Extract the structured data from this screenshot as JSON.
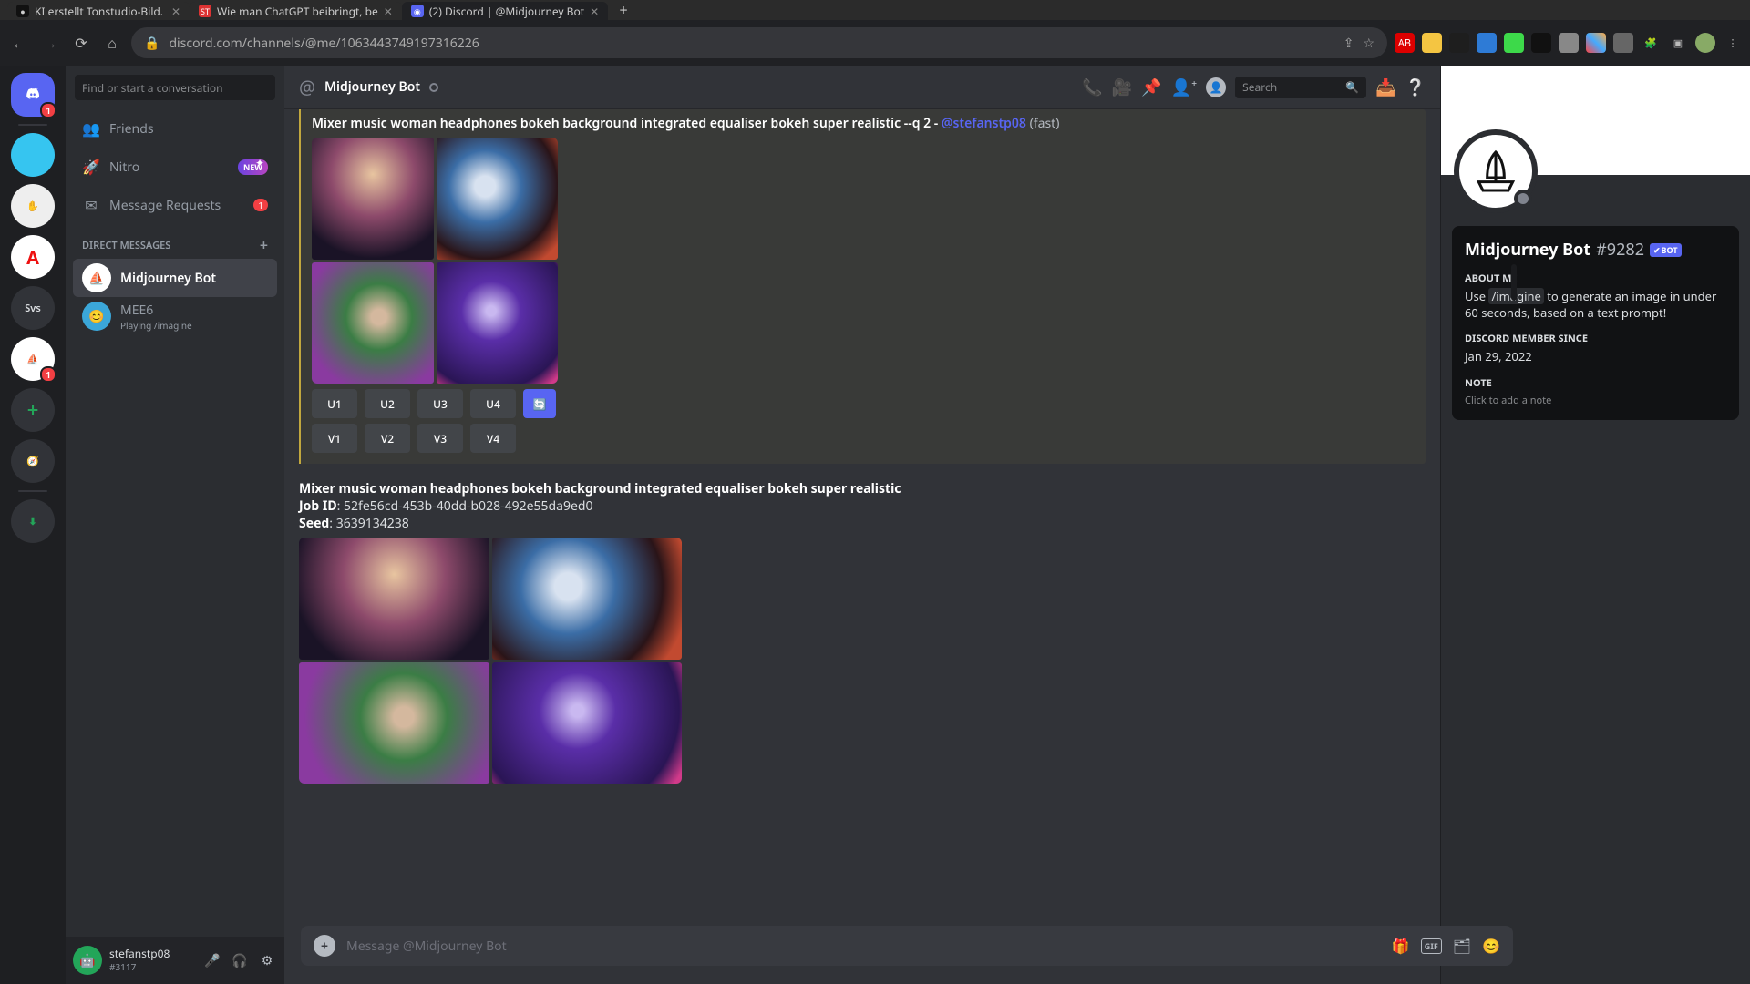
{
  "browser": {
    "tabs": [
      {
        "title": "KI erstellt Tonstudio-Bild.",
        "fav_bg": "#111",
        "fav_txt": "●"
      },
      {
        "title": "Wie man ChatGPT beibringt, be",
        "fav_bg": "#d33",
        "fav_txt": "ST"
      },
      {
        "title": "(2) Discord | @Midjourney Bot",
        "fav_bg": "#5865f2",
        "fav_txt": "●"
      }
    ],
    "url": "discord.com/channels/@me/106344374919731622­6"
  },
  "rail": {
    "discord_badge": "1",
    "servers": [
      {
        "label": "",
        "bg": "#36c5f0"
      },
      {
        "label": "",
        "bg": "#eeeeee",
        "badge": ""
      },
      {
        "label": "A",
        "bg": "#ffffff",
        "color": "#e11"
      },
      {
        "label": "Svs",
        "bg": "#313338"
      },
      {
        "label": "",
        "bg": "#ffffff",
        "badge": "1"
      }
    ]
  },
  "dm": {
    "find_placeholder": "Find or start a conversation",
    "friends": "Friends",
    "nitro": "Nitro",
    "new_chip": "NEW",
    "requests": "Message Requests",
    "requests_badge": "1",
    "dm_header": "DIRECT MESSAGES",
    "items": [
      {
        "name": "Midjourney Bot",
        "sub": "",
        "sel": true
      },
      {
        "name": "MEE6",
        "sub": "Playing /imagine",
        "sel": false
      }
    ],
    "user": {
      "name": "stefanstp08",
      "tag": "#3117"
    }
  },
  "head": {
    "title": "Midjourney Bot",
    "search_placeholder": "Search"
  },
  "msg1": {
    "prompt": "Mixer music woman headphones bokeh background integrated equaliser bokeh super realistic --q 2",
    "mention": "@stefanstp08",
    "fast": "(fast)",
    "buttons_u": [
      "U1",
      "U2",
      "U3",
      "U4"
    ],
    "buttons_v": [
      "V1",
      "V2",
      "V3",
      "V4"
    ],
    "reroll": "🔄"
  },
  "msg2": {
    "prompt": "Mixer music woman headphones bokeh background integrated equaliser bokeh super realistic",
    "job_label": "Job ID",
    "job_id": "52fe56cd-453b-40dd-b028-492e55da9ed0",
    "seed_label": "Seed",
    "seed": "3639134238"
  },
  "input_placeholder": "Message @Midjourney Bot",
  "profile": {
    "name": "Midjourney Bot",
    "discrim": "#9282",
    "bot": "BOT",
    "about_lbl": "ABOUT ME",
    "about_pre": "Use ",
    "about_code": "/imagine",
    "about_post": " to generate an image in under 60 seconds, based on a text prompt!",
    "since_lbl": "DISCORD MEMBER SINCE",
    "since": "Jan 29, 2022",
    "note_lbl": "NOTE",
    "note_ph": "Click to add a note"
  },
  "btn_labels": {
    "gif": "GIF"
  }
}
